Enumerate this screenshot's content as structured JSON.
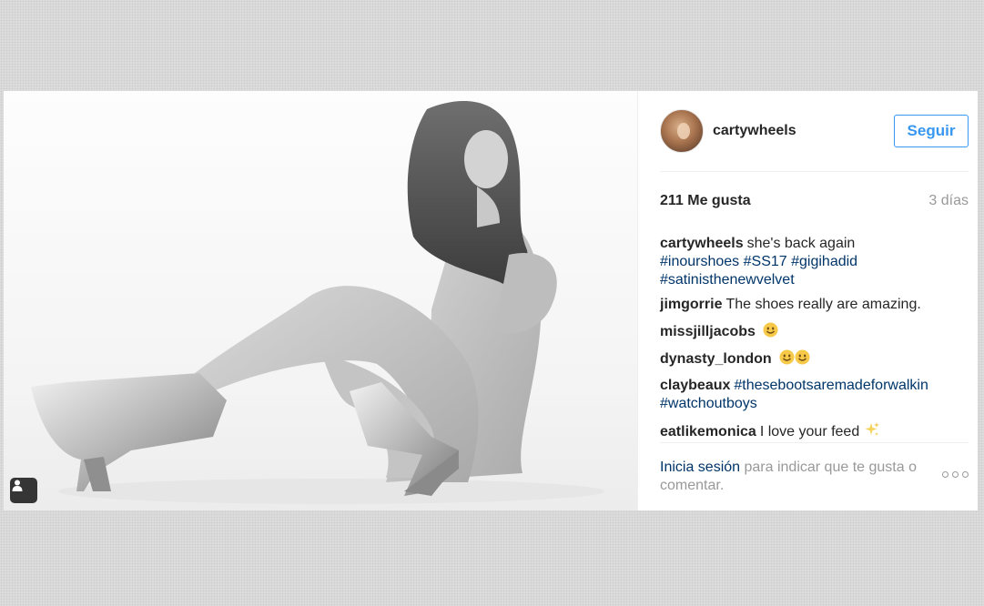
{
  "post": {
    "username": "cartywheels",
    "follow_label": "Seguir",
    "likes": "211 Me gusta",
    "time": "3 días",
    "comments": [
      {
        "author": "cartywheels",
        "text": "she's back again",
        "tags": [
          "#inourshoes",
          "#SS17",
          "#gigihadid",
          "#satinisthenewvelvet"
        ]
      },
      {
        "author": "jimgorrie",
        "text": "The shoes really are amazing."
      },
      {
        "author": "missjilljacobs",
        "emoji": [
          "smiling-face-icon"
        ]
      },
      {
        "author": "dynasty_london",
        "emoji": [
          "smiling-face-icon",
          "smiling-face-icon"
        ]
      },
      {
        "author": "claybeaux",
        "tags": [
          "#thesebootsaremadeforwalkin",
          "#watchoutboys"
        ]
      },
      {
        "author": "eatlikemonica",
        "text": "I love your feed",
        "emoji": [
          "sparkles-icon"
        ]
      }
    ],
    "footer": {
      "login_link": "Inicia sesión",
      "login_text": "para indicar que te gusta o comentar."
    }
  },
  "colors": {
    "link": "#003569",
    "follow": "#3897f0",
    "muted": "#999999",
    "text": "#262626"
  }
}
